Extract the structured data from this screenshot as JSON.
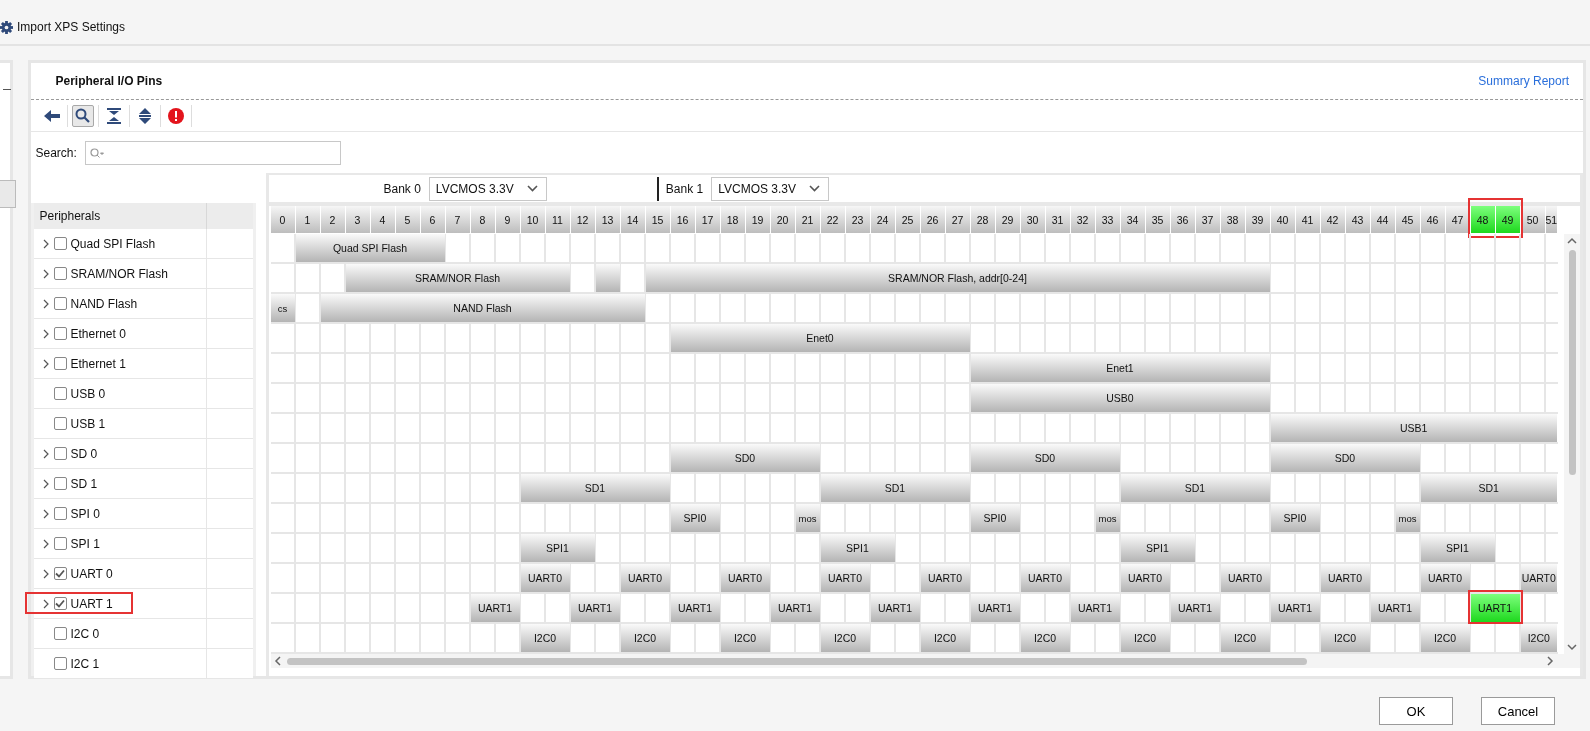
{
  "title_bar": {
    "title": "Import XPS Settings"
  },
  "panel": {
    "title": "Peripheral I/O Pins",
    "link": "Summary Report"
  },
  "toolbar": [
    {
      "kind": "back",
      "pressed": false
    },
    {
      "kind": "search",
      "pressed": true
    },
    {
      "kind": "collapse",
      "pressed": false
    },
    {
      "kind": "expand",
      "pressed": false
    },
    {
      "kind": "error",
      "pressed": false
    }
  ],
  "search": {
    "label": "Search:"
  },
  "peripherals": {
    "header": "Peripherals",
    "items": [
      {
        "label": "Quad SPI Flash",
        "expandable": true,
        "checked": false,
        "outlined": false
      },
      {
        "label": "SRAM/NOR Flash",
        "expandable": true,
        "checked": false,
        "outlined": false
      },
      {
        "label": "NAND Flash",
        "expandable": true,
        "checked": false,
        "outlined": false
      },
      {
        "label": "Ethernet 0",
        "expandable": true,
        "checked": false,
        "outlined": false
      },
      {
        "label": "Ethernet 1",
        "expandable": true,
        "checked": false,
        "outlined": false
      },
      {
        "label": "USB 0",
        "expandable": false,
        "checked": false,
        "outlined": false
      },
      {
        "label": "USB 1",
        "expandable": false,
        "checked": false,
        "outlined": false
      },
      {
        "label": "SD 0",
        "expandable": true,
        "checked": false,
        "outlined": false
      },
      {
        "label": "SD 1",
        "expandable": true,
        "checked": false,
        "outlined": false
      },
      {
        "label": "SPI 0",
        "expandable": true,
        "checked": false,
        "outlined": false
      },
      {
        "label": "SPI 1",
        "expandable": true,
        "checked": false,
        "outlined": false
      },
      {
        "label": "UART 0",
        "expandable": true,
        "checked": true,
        "outlined": false
      },
      {
        "label": "UART 1",
        "expandable": true,
        "checked": true,
        "outlined": true
      },
      {
        "label": "I2C 0",
        "expandable": false,
        "checked": false,
        "outlined": false
      },
      {
        "label": "I2C 1",
        "expandable": false,
        "checked": false,
        "outlined": false
      }
    ]
  },
  "banks": [
    {
      "label": "Bank 0",
      "value": "LVCMOS 3.3V"
    },
    {
      "label": "Bank 1",
      "value": "LVCMOS 3.3V"
    }
  ],
  "pins": [
    {
      "label": "0",
      "selected": false,
      "outlined": false
    },
    {
      "label": "1",
      "selected": false,
      "outlined": false
    },
    {
      "label": "2",
      "selected": false,
      "outlined": false
    },
    {
      "label": "3",
      "selected": false,
      "outlined": false
    },
    {
      "label": "4",
      "selected": false,
      "outlined": false
    },
    {
      "label": "5",
      "selected": false,
      "outlined": false
    },
    {
      "label": "6",
      "selected": false,
      "outlined": false
    },
    {
      "label": "7",
      "selected": false,
      "outlined": false
    },
    {
      "label": "8",
      "selected": false,
      "outlined": false
    },
    {
      "label": "9",
      "selected": false,
      "outlined": false
    },
    {
      "label": "10",
      "selected": false,
      "outlined": false
    },
    {
      "label": "11",
      "selected": false,
      "outlined": false
    },
    {
      "label": "12",
      "selected": false,
      "outlined": false
    },
    {
      "label": "13",
      "selected": false,
      "outlined": false
    },
    {
      "label": "14",
      "selected": false,
      "outlined": false
    },
    {
      "label": "15",
      "selected": false,
      "outlined": false
    },
    {
      "label": "16",
      "selected": false,
      "outlined": false
    },
    {
      "label": "17",
      "selected": false,
      "outlined": false
    },
    {
      "label": "18",
      "selected": false,
      "outlined": false
    },
    {
      "label": "19",
      "selected": false,
      "outlined": false
    },
    {
      "label": "20",
      "selected": false,
      "outlined": false
    },
    {
      "label": "21",
      "selected": false,
      "outlined": false
    },
    {
      "label": "22",
      "selected": false,
      "outlined": false
    },
    {
      "label": "23",
      "selected": false,
      "outlined": false
    },
    {
      "label": "24",
      "selected": false,
      "outlined": false
    },
    {
      "label": "25",
      "selected": false,
      "outlined": false
    },
    {
      "label": "26",
      "selected": false,
      "outlined": false
    },
    {
      "label": "27",
      "selected": false,
      "outlined": false
    },
    {
      "label": "28",
      "selected": false,
      "outlined": false
    },
    {
      "label": "29",
      "selected": false,
      "outlined": false
    },
    {
      "label": "30",
      "selected": false,
      "outlined": false
    },
    {
      "label": "31",
      "selected": false,
      "outlined": false
    },
    {
      "label": "32",
      "selected": false,
      "outlined": false
    },
    {
      "label": "33",
      "selected": false,
      "outlined": false
    },
    {
      "label": "34",
      "selected": false,
      "outlined": false
    },
    {
      "label": "35",
      "selected": false,
      "outlined": false
    },
    {
      "label": "36",
      "selected": false,
      "outlined": false
    },
    {
      "label": "37",
      "selected": false,
      "outlined": false
    },
    {
      "label": "38",
      "selected": false,
      "outlined": false
    },
    {
      "label": "39",
      "selected": false,
      "outlined": false
    },
    {
      "label": "40",
      "selected": false,
      "outlined": false
    },
    {
      "label": "41",
      "selected": false,
      "outlined": false
    },
    {
      "label": "42",
      "selected": false,
      "outlined": false
    },
    {
      "label": "43",
      "selected": false,
      "outlined": false
    },
    {
      "label": "44",
      "selected": false,
      "outlined": false
    },
    {
      "label": "45",
      "selected": false,
      "outlined": false
    },
    {
      "label": "46",
      "selected": false,
      "outlined": false
    },
    {
      "label": "47",
      "selected": false,
      "outlined": false
    },
    {
      "label": "48",
      "selected": true,
      "outlined": true
    },
    {
      "label": "49",
      "selected": true,
      "outlined": true
    },
    {
      "label": "50",
      "selected": false,
      "outlined": false
    },
    {
      "label": "51",
      "selected": false,
      "outlined": false
    }
  ],
  "rows": [
    {
      "bars": [
        {
          "label": "Quad SPI Flash",
          "selected": false,
          "outlined": false
        }
      ]
    },
    {
      "bars": [
        {
          "label": "SRAM/NOR Flash",
          "selected": false,
          "outlined": false
        },
        {
          "selected": false,
          "outlined": false
        },
        {
          "label": "SRAM/NOR Flash, addr[0-24]",
          "selected": false,
          "outlined": false
        }
      ]
    },
    {
      "bars": [
        {
          "label": "cs",
          "selected": false,
          "outlined": false
        },
        {
          "label": "NAND Flash",
          "selected": false,
          "outlined": false
        }
      ]
    },
    {
      "bars": [
        {
          "label": "Enet0",
          "selected": false,
          "outlined": false
        }
      ]
    },
    {
      "bars": [
        {
          "label": "Enet1",
          "selected": false,
          "outlined": false
        }
      ]
    },
    {
      "bars": [
        {
          "label": "USB0",
          "selected": false,
          "outlined": false
        }
      ]
    },
    {
      "bars": [
        {
          "label": "USB1",
          "selected": false,
          "outlined": false
        }
      ]
    },
    {
      "bars": [
        {
          "label": "SD0",
          "selected": false,
          "outlined": false
        },
        {
          "label": "SD0",
          "selected": false,
          "outlined": false
        },
        {
          "label": "SD0",
          "selected": false,
          "outlined": false
        }
      ]
    },
    {
      "bars": [
        {
          "label": "SD1",
          "selected": false,
          "outlined": false
        },
        {
          "label": "SD1",
          "selected": false,
          "outlined": false
        },
        {
          "label": "SD1",
          "selected": false,
          "outlined": false
        },
        {
          "label": "SD1",
          "selected": false,
          "outlined": false
        }
      ]
    },
    {
      "bars": [
        {
          "label": "SPI0",
          "selected": false,
          "outlined": false
        },
        {
          "label": "mos",
          "selected": false,
          "outlined": false
        },
        {
          "label": "SPI0",
          "selected": false,
          "outlined": false
        },
        {
          "label": "mos",
          "selected": false,
          "outlined": false
        },
        {
          "label": "SPI0",
          "selected": false,
          "outlined": false
        },
        {
          "label": "mos",
          "selected": false,
          "outlined": false
        }
      ]
    },
    {
      "bars": [
        {
          "label": "SPI1",
          "selected": false,
          "outlined": false
        },
        {
          "label": "SPI1",
          "selected": false,
          "outlined": false
        },
        {
          "label": "SPI1",
          "selected": false,
          "outlined": false
        },
        {
          "label": "SPI1",
          "selected": false,
          "outlined": false
        }
      ]
    },
    {
      "bars": [
        {
          "label": "UART0",
          "selected": false,
          "outlined": false
        },
        {
          "label": "UART0",
          "selected": false,
          "outlined": false
        },
        {
          "label": "UART0",
          "selected": false,
          "outlined": false
        },
        {
          "label": "UART0",
          "selected": false,
          "outlined": false
        },
        {
          "label": "UART0",
          "selected": false,
          "outlined": false
        },
        {
          "label": "UART0",
          "selected": false,
          "outlined": false
        },
        {
          "label": "UART0",
          "selected": false,
          "outlined": false
        },
        {
          "label": "UART0",
          "selected": false,
          "outlined": false
        },
        {
          "label": "UART0",
          "selected": false,
          "outlined": false
        },
        {
          "label": "UART0",
          "selected": false,
          "outlined": false
        },
        {
          "label": "UART0",
          "selected": false,
          "outlined": false
        }
      ]
    },
    {
      "bars": [
        {
          "label": "UART1",
          "selected": false,
          "outlined": false
        },
        {
          "label": "UART1",
          "selected": false,
          "outlined": false
        },
        {
          "label": "UART1",
          "selected": false,
          "outlined": false
        },
        {
          "label": "UART1",
          "selected": false,
          "outlined": false
        },
        {
          "label": "UART1",
          "selected": false,
          "outlined": false
        },
        {
          "label": "UART1",
          "selected": false,
          "outlined": false
        },
        {
          "label": "UART1",
          "selected": false,
          "outlined": false
        },
        {
          "label": "UART1",
          "selected": false,
          "outlined": false
        },
        {
          "label": "UART1",
          "selected": false,
          "outlined": false
        },
        {
          "label": "UART1",
          "selected": false,
          "outlined": false
        },
        {
          "label": "UART1",
          "selected": true,
          "outlined": true
        }
      ]
    },
    {
      "bars": [
        {
          "label": "I2C0",
          "selected": false,
          "outlined": false
        },
        {
          "label": "I2C0",
          "selected": false,
          "outlined": false
        },
        {
          "label": "I2C0",
          "selected": false,
          "outlined": false
        },
        {
          "label": "I2C0",
          "selected": false,
          "outlined": false
        },
        {
          "label": "I2C0",
          "selected": false,
          "outlined": false
        },
        {
          "label": "I2C0",
          "selected": false,
          "outlined": false
        },
        {
          "label": "I2C0",
          "selected": false,
          "outlined": false
        },
        {
          "label": "I2C0",
          "selected": false,
          "outlined": false
        },
        {
          "label": "I2C0",
          "selected": false,
          "outlined": false
        },
        {
          "label": "I2C0",
          "selected": false,
          "outlined": false
        },
        {
          "label": "I2C0",
          "selected": false,
          "outlined": false
        }
      ]
    }
  ],
  "buttons": [
    "OK",
    "Cancel"
  ]
}
